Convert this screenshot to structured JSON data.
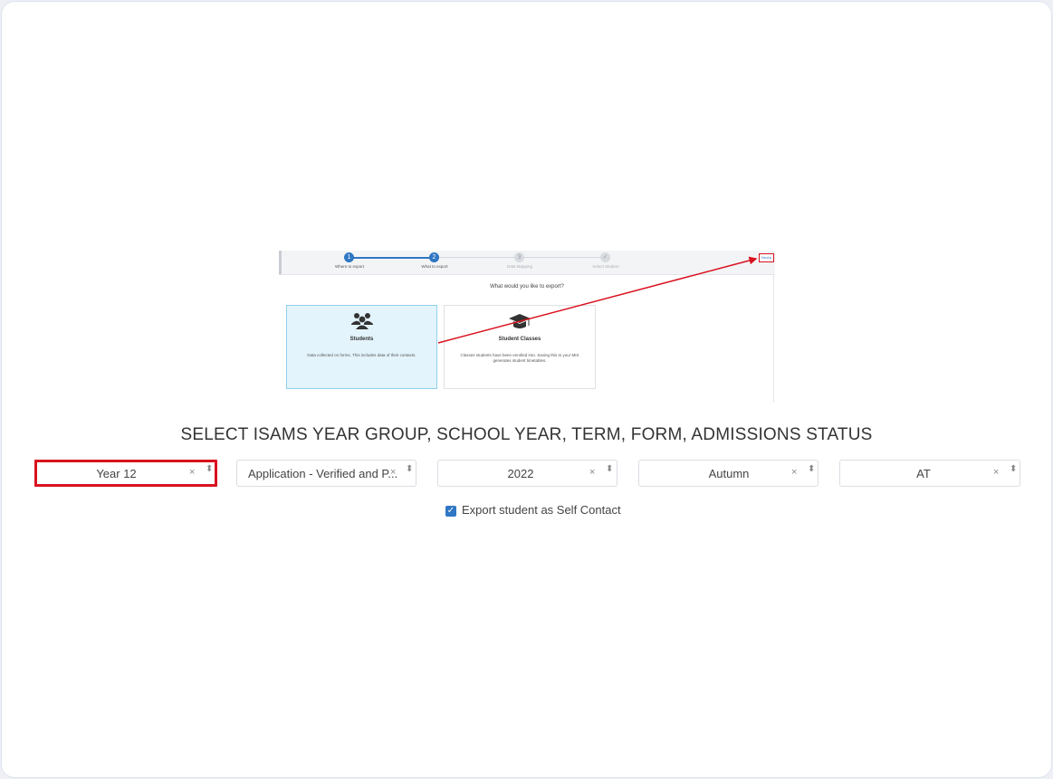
{
  "embedded_screenshot": {
    "steps": [
      {
        "label": "Where to export",
        "state": "done",
        "marker": "1"
      },
      {
        "label": "What to export",
        "state": "active",
        "marker": "2"
      },
      {
        "label": "Data Mapping",
        "state": "todo",
        "marker": "3"
      },
      {
        "label": "Select Student",
        "state": "todo",
        "marker": "✓"
      }
    ],
    "next_label": "Next ▸",
    "question": "What would you like to export?",
    "options": [
      {
        "title": "Students",
        "description": "Data collected on forms. This includes data of their contacts.",
        "icon": "users-icon",
        "selected": true
      },
      {
        "title": "Student Classes",
        "description": "Classes students have been enrolled into. Saving this to your MIS generates student timetables.",
        "icon": "graduation-cap-icon",
        "selected": false
      }
    ],
    "annotation_color": "#d9121f"
  },
  "title": "SELECT ISAMS YEAR GROUP, SCHOOL YEAR, TERM, FORM, ADMISSIONS STATUS",
  "filters": [
    {
      "value": "Year 12",
      "highlighted": true
    },
    {
      "value": "Application - Verified and P...",
      "highlighted": false
    },
    {
      "value": "2022",
      "highlighted": false
    },
    {
      "value": "Autumn",
      "highlighted": false
    },
    {
      "value": "AT",
      "highlighted": false
    }
  ],
  "clear_glyph": "×",
  "arrows_glyph": "⬍",
  "checkbox": {
    "label": "Export student as Self Contact",
    "checked": true
  },
  "colors": {
    "accent": "#2f77c4",
    "highlight": "#d9121f",
    "selected_card": "#e3f4fc"
  }
}
